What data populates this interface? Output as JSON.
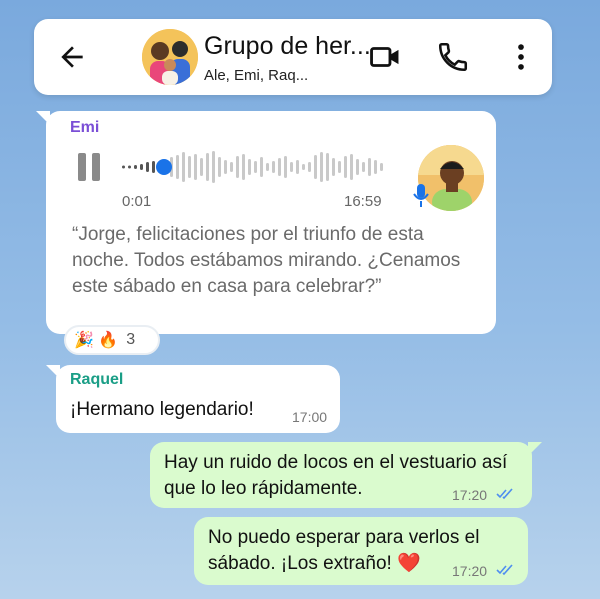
{
  "header": {
    "title": "Grupo de her...",
    "subtitle": "Ale, Emi, Raq...",
    "icons": [
      "back-arrow-icon",
      "video-call-icon",
      "phone-icon",
      "more-vert-icon"
    ]
  },
  "audio_message": {
    "sender": "Emi",
    "sender_color": "#7b4fd6",
    "elapsed": "0:01",
    "time": "16:59",
    "progress": 0.05,
    "transcript": "“Jorge, felicitaciones por el triunfo de esta noche. Todos estábamos mirando. ¿Cenamos este sábado en casa para celebrar?”",
    "reactions": {
      "emojis": "🎉 🔥",
      "count": "3"
    }
  },
  "messages": [
    {
      "sender": "Raquel",
      "sender_color": "#1a9e86",
      "text": "¡Hermano legendario!",
      "time": "17:00",
      "direction": "in"
    },
    {
      "text": "Hay un ruido de locos en el vestuario así que lo leo rápidamente.",
      "time": "17:20",
      "direction": "out",
      "read": true
    },
    {
      "text": "No puedo esperar para verlos el sábado. ¡Los extraño! ❤️",
      "time": "17:20",
      "direction": "out",
      "read": true
    }
  ],
  "colors": {
    "read_ticks": "#4f8ef0",
    "out_bubble": "#dafbce",
    "accent_blue": "#1a73e8"
  }
}
